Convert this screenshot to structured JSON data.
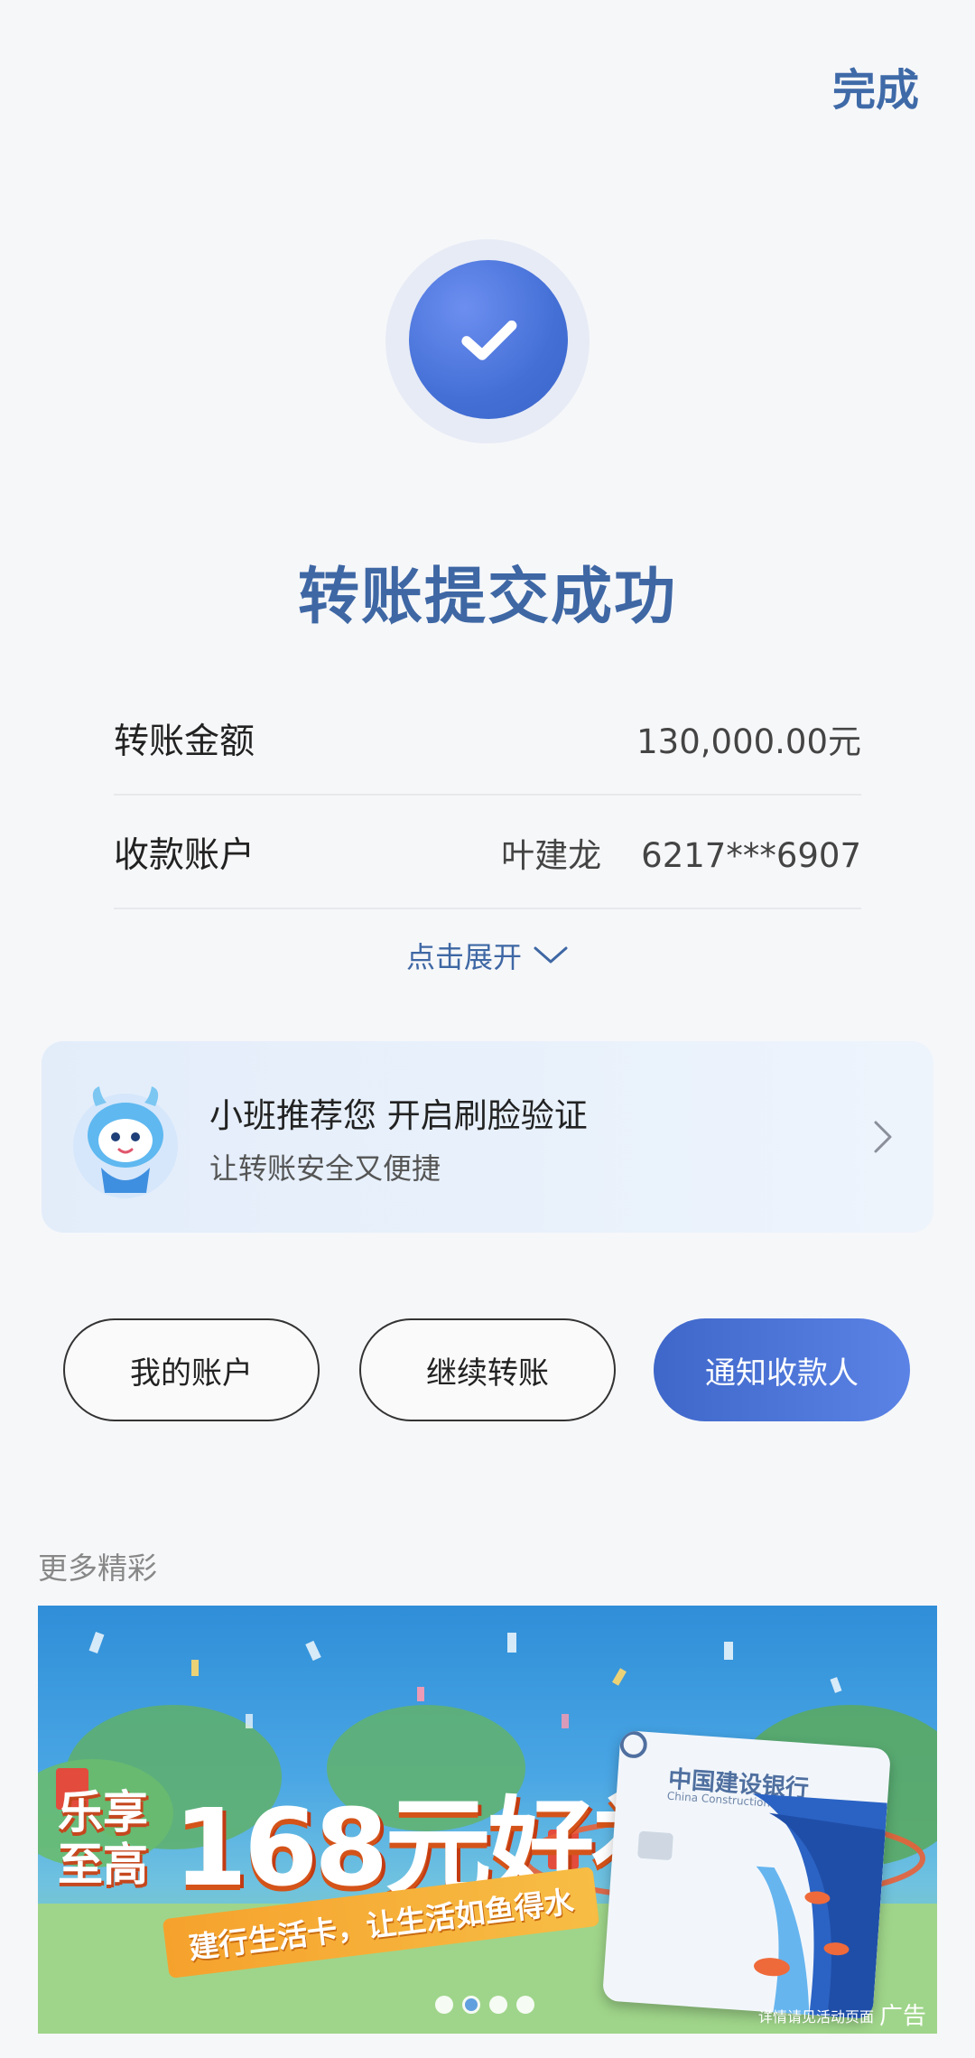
{
  "header": {
    "done_label": "完成"
  },
  "status": {
    "title": "转账提交成功",
    "check_icon": "checkmark-icon",
    "accent": "#4470d6"
  },
  "details": {
    "amount_label": "转账金额",
    "amount_value": "130,000.00元",
    "payee_label": "收款账户",
    "payee_name": "叶建龙",
    "payee_account": "6217***6907",
    "expand_label": "点击展开"
  },
  "promo": {
    "title": "小班推荐您 开启刷脸验证",
    "subtitle": "让转账安全又便捷"
  },
  "actions": {
    "my_account": "我的账户",
    "continue_transfer": "继续转账",
    "notify_payee": "通知收款人"
  },
  "more": {
    "label": "更多精彩"
  },
  "banner": {
    "lexiang": "乐享至高",
    "big_text": "168元好礼",
    "ribbon": "建行生活卡，让生活如鱼得水",
    "bank_name": "中国建设银行",
    "bank_name_en": "China Construction Bank",
    "note": "详情请见活动页面",
    "ad_tag": "广告",
    "carousel_total": 4,
    "carousel_active": 2
  }
}
